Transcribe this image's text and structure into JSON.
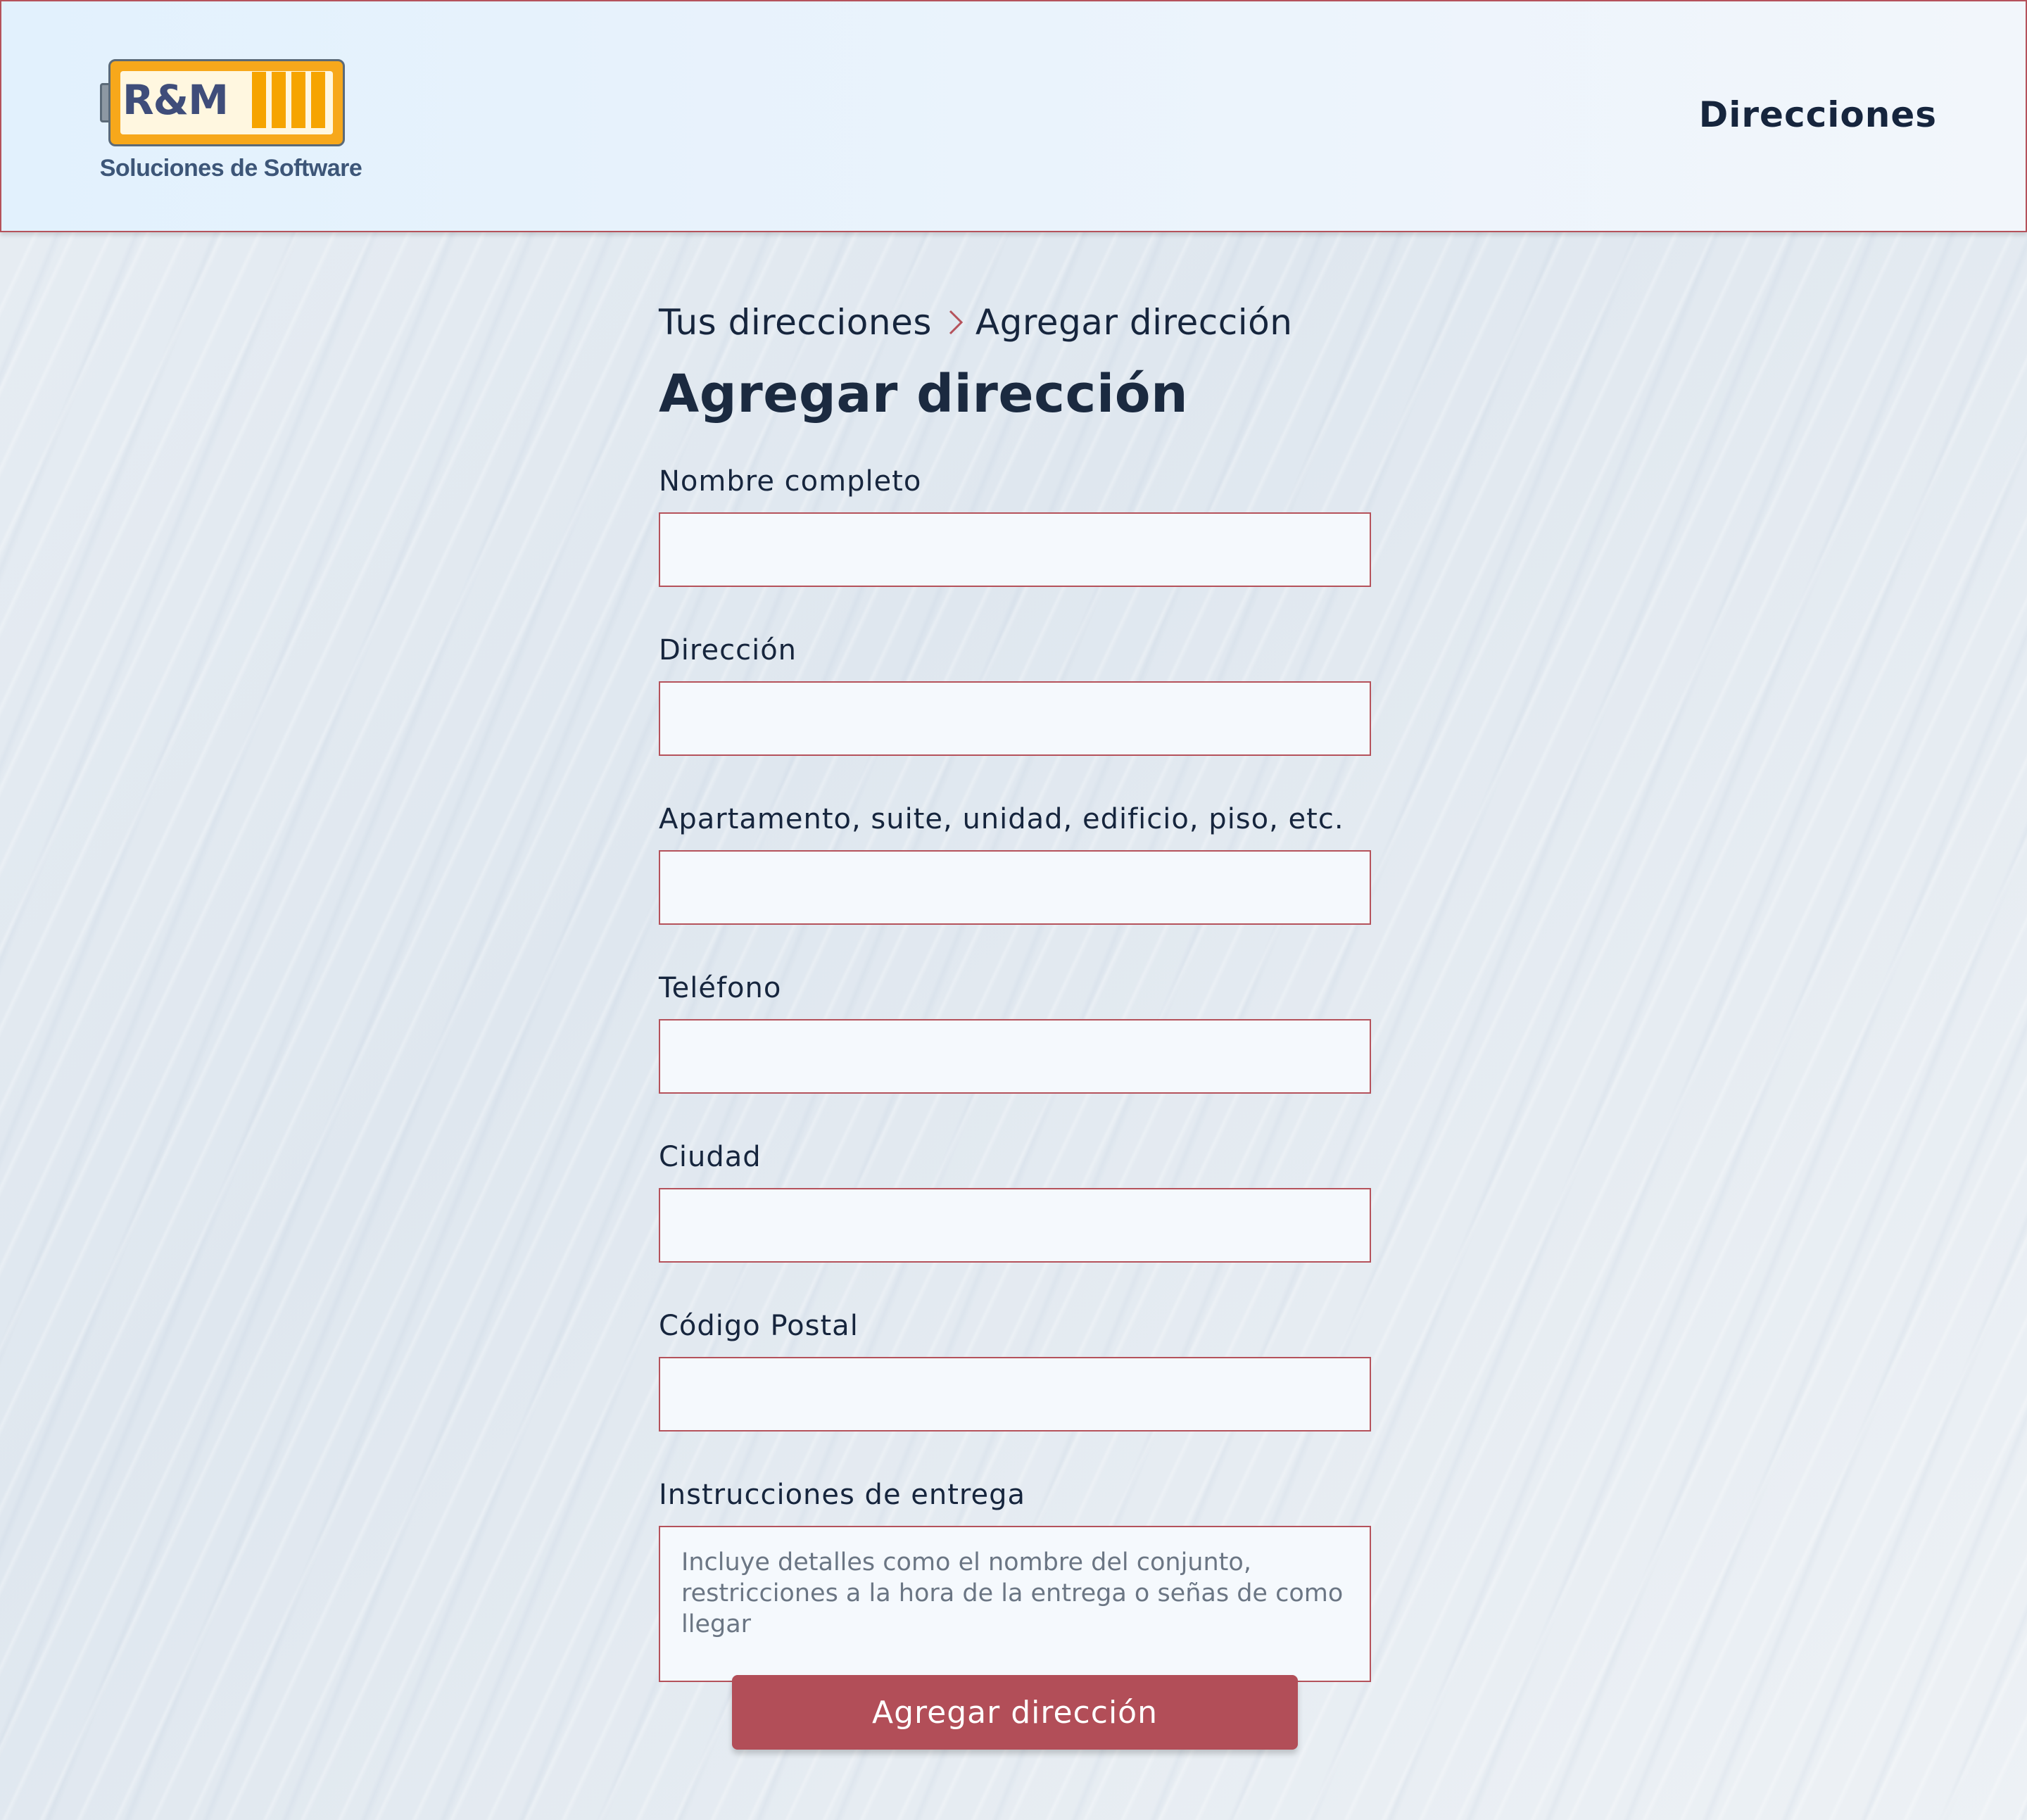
{
  "header": {
    "logo": {
      "brand": "R&M",
      "tagline": "Soluciones de Software"
    },
    "nav_title": "Direcciones"
  },
  "breadcrumb": {
    "parent": "Tus direcciones",
    "separator_icon": "chevron-right-icon",
    "current": "Agregar dirección"
  },
  "page": {
    "title": "Agregar dirección"
  },
  "form": {
    "fields": [
      {
        "label": "Nombre completo",
        "value": "",
        "placeholder": ""
      },
      {
        "label": "Dirección",
        "value": "",
        "placeholder": ""
      },
      {
        "label": "Apartamento, suite, unidad, edificio, piso, etc.",
        "value": "",
        "placeholder": ""
      },
      {
        "label": "Teléfono",
        "value": "",
        "placeholder": ""
      },
      {
        "label": "Ciudad",
        "value": "",
        "placeholder": ""
      },
      {
        "label": "Código Postal",
        "value": "",
        "placeholder": ""
      }
    ],
    "instructions": {
      "label": "Instrucciones de entrega",
      "value": "",
      "placeholder": "Incluye detalles como el nombre del conjunto, restricciones a la hora de la entrega o señas de como llegar"
    },
    "submit_label": "Agregar dirección"
  },
  "colors": {
    "accent": "#b24e58",
    "border": "#b5525b",
    "text": "#16253d",
    "logo_orange": "#f6a400",
    "logo_navy": "#3f4d7a"
  }
}
